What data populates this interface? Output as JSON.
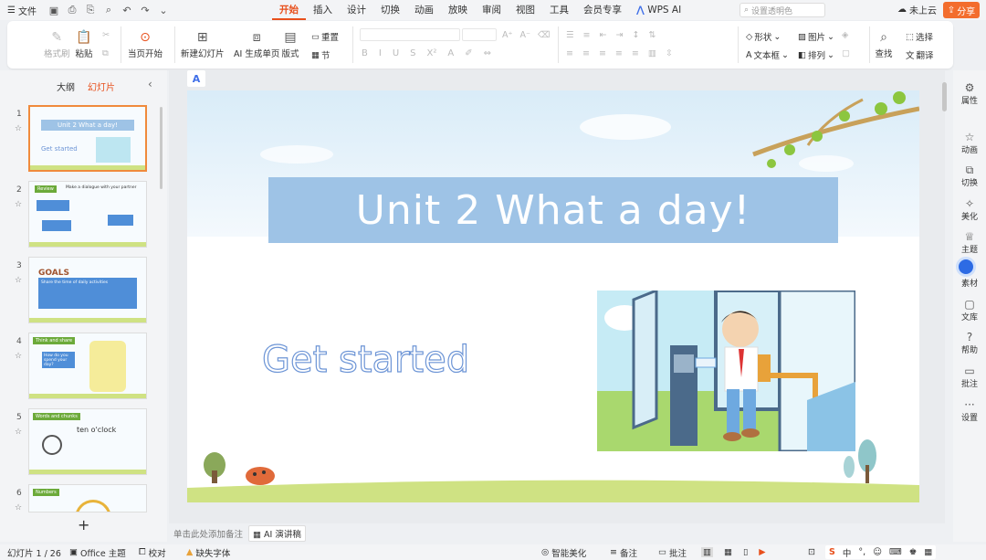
{
  "topbar": {
    "file_label": "文件",
    "tabs": [
      "开始",
      "插入",
      "设计",
      "切换",
      "动画",
      "放映",
      "审阅",
      "视图",
      "工具",
      "会员专享",
      "WPS AI"
    ],
    "search_placeholder": "设置透明色",
    "cloud_label": "未上云",
    "share_label": "分享"
  },
  "ribbon": {
    "format_painter": "格式刷",
    "paste": "粘贴",
    "play_from_current": "当页开始",
    "new_slide": "新建幻灯片",
    "ai_generate": "AI 生成单页",
    "layout": "版式",
    "reset": "重置",
    "section": "节",
    "shape": "形状",
    "picture": "图片",
    "textbox": "文本框",
    "arrange": "排列",
    "find": "查找",
    "select": "选择",
    "translate": "翻译"
  },
  "left_panel": {
    "tab_outline": "大纲",
    "tab_slides": "幻灯片",
    "slides": [
      {
        "num": "1",
        "title": "Unit 2  What a day!",
        "sub": "Get started"
      },
      {
        "num": "2",
        "title": "Review",
        "sub": "Make a dialogue with your partner"
      },
      {
        "num": "3",
        "title": "GOALS",
        "sub": "Share the time of daily activities"
      },
      {
        "num": "4",
        "title": "Think and share",
        "sub": "How do you spend your day?"
      },
      {
        "num": "5",
        "title": "Words and chunks",
        "sub": "ten o'clock"
      },
      {
        "num": "6",
        "title": "Numbers",
        "sub": ""
      }
    ]
  },
  "slide": {
    "title": "Unit 2  What a day!",
    "subtitle": "Get started",
    "badge": "A"
  },
  "notes": {
    "placeholder": "单击此处添加备注",
    "ai_speech": "AI 演讲稿"
  },
  "right_panel": [
    "属性",
    "动画",
    "切换",
    "美化",
    "主题",
    "素材",
    "文库",
    "帮助",
    "批注",
    "设置"
  ],
  "status": {
    "slide_count": "幻灯片 1 / 26",
    "theme": "Office 主题",
    "proofread": "校对",
    "missing_font": "缺失字体",
    "smart_beautify": "智能美化",
    "notes": "备注",
    "comments": "批注"
  },
  "colors": {
    "accent": "#e8501c",
    "title_bar": "#9ec3e6",
    "get_started_stroke": "#6d95d6",
    "share": "#f36d2d"
  }
}
